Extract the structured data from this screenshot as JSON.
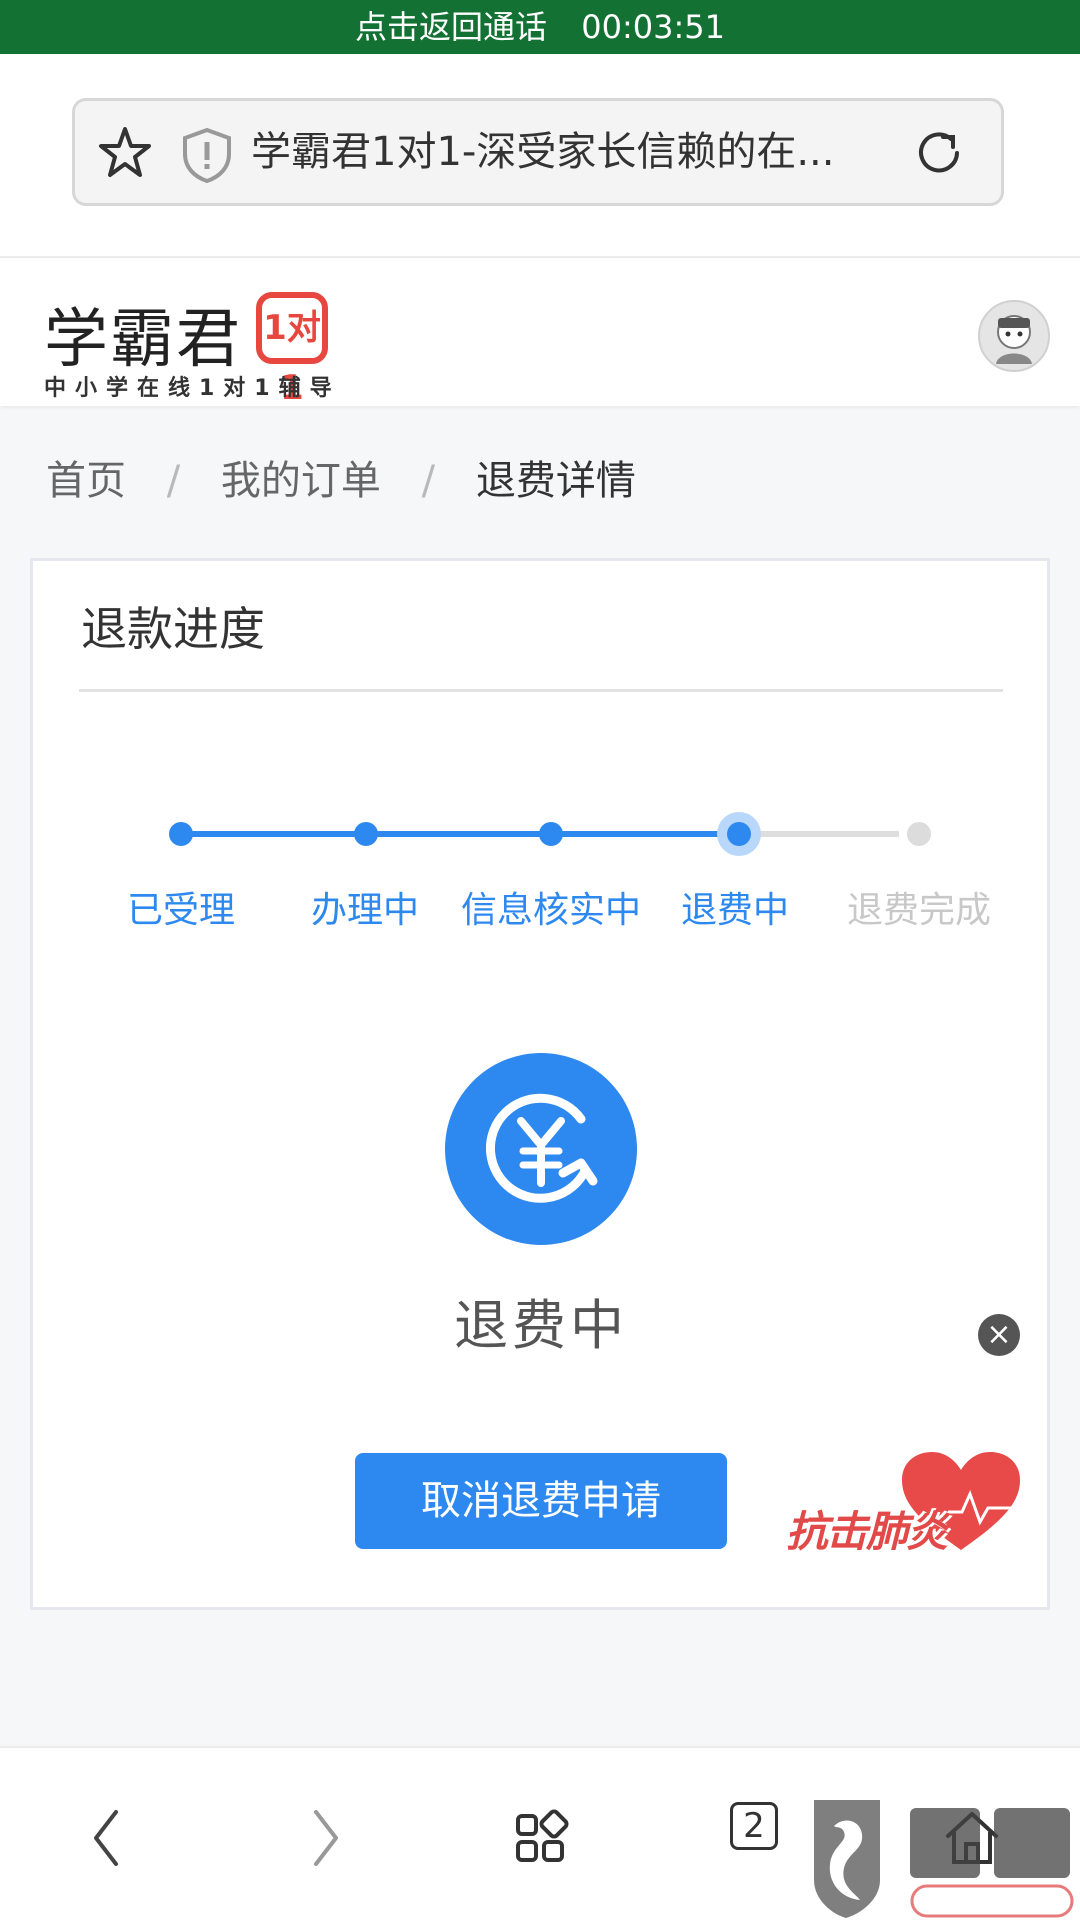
{
  "call_bar": {
    "text": "点击返回通话",
    "timer": "00:03:51"
  },
  "browser": {
    "page_title": "学霸君1对1-深受家长信赖的在...",
    "tab_count": "2"
  },
  "site": {
    "logo_main": "学霸君",
    "logo_badge": "1对1",
    "logo_sub": "中小学在线1对1辅导"
  },
  "breadcrumb": {
    "items": [
      "首页",
      "我的订单",
      "退费详情"
    ],
    "separator": "/"
  },
  "refund": {
    "title": "退款进度",
    "steps": [
      {
        "label": "已受理",
        "state": "done"
      },
      {
        "label": "办理中",
        "state": "done"
      },
      {
        "label": "信息核实中",
        "state": "done"
      },
      {
        "label": "退费中",
        "state": "current"
      },
      {
        "label": "退费完成",
        "state": "todo"
      }
    ],
    "status": "退费中",
    "cancel_label": "取消退费申请"
  },
  "promo": {
    "text": "抗击肺炎"
  },
  "colors": {
    "accent": "#2d89ef",
    "call_bar": "#137233",
    "promo_red": "#e24a4a"
  },
  "icons": [
    "star-icon",
    "shield-icon",
    "reload-icon",
    "yuan-refund-icon",
    "close-icon",
    "heart-icon",
    "back-icon",
    "forward-icon",
    "apps-icon",
    "home-icon"
  ]
}
